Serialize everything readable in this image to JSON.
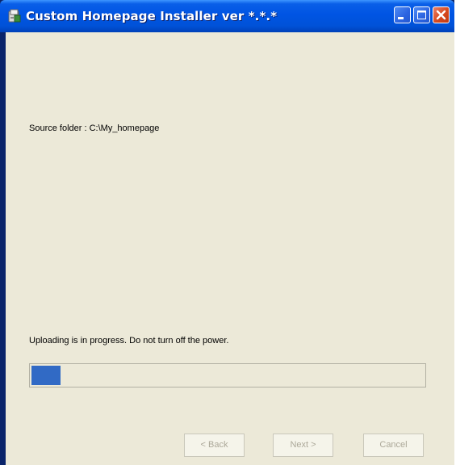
{
  "window": {
    "title": "Custom Homepage Installer ver *.*.*"
  },
  "source": {
    "label": "Source folder : C:\\My_homepage"
  },
  "status": {
    "message": "Uploading is in progress. Do not turn off the power."
  },
  "progress": {
    "fraction": 0.075,
    "color": "#316ac5"
  },
  "buttons": {
    "back": "< Back",
    "next": "Next >",
    "cancel": "Cancel"
  },
  "colors": {
    "titlebar": "#0054e3",
    "client_background": "#ece9d8",
    "disabled_text": "#aca899"
  }
}
